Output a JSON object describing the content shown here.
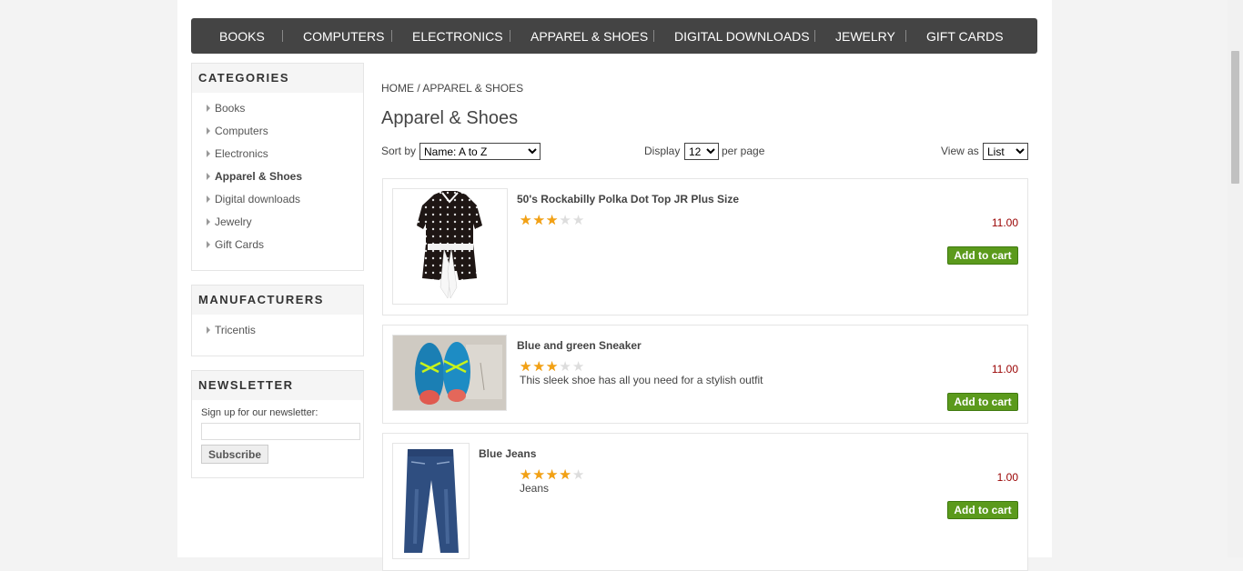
{
  "top_menu": [
    "BOOKS",
    "COMPUTERS",
    "ELECTRONICS",
    "APPAREL & SHOES",
    "DIGITAL DOWNLOADS",
    "JEWELRY",
    "GIFT CARDS"
  ],
  "categories": {
    "title": "CATEGORIES",
    "items": [
      "Books",
      "Computers",
      "Electronics",
      "Apparel & Shoes",
      "Digital downloads",
      "Jewelry",
      "Gift Cards"
    ],
    "active": "Apparel & Shoes"
  },
  "manufacturers": {
    "title": "MANUFACTURERS",
    "items": [
      "Tricentis"
    ]
  },
  "newsletter": {
    "title": "NEWSLETTER",
    "label": "Sign up for our newsletter:",
    "input_value": "",
    "button": "Subscribe"
  },
  "breadcrumb": {
    "home": "HOME",
    "separator": "/",
    "current": "APPAREL & SHOES"
  },
  "page_title": "Apparel & Shoes",
  "sort": {
    "label": "Sort by",
    "selected": "Name: A to Z"
  },
  "display": {
    "label": "Display",
    "selected": "12",
    "suffix": "per page"
  },
  "view": {
    "label": "View as",
    "selected": "List"
  },
  "products": [
    {
      "name": "50's Rockabilly Polka Dot Top JR Plus Size",
      "rating": 3,
      "max_rating": 5,
      "description": "",
      "price": "11.00",
      "button": "Add to cart",
      "image_icon": "polka-dot-top-image"
    },
    {
      "name": "Blue and green Sneaker",
      "rating": 3,
      "max_rating": 5,
      "description": "This sleek shoe has all you need for a stylish outfit",
      "price": "11.00",
      "button": "Add to cart",
      "image_icon": "sneaker-image"
    },
    {
      "name": "Blue Jeans",
      "rating": 4,
      "max_rating": 5,
      "description": "Jeans",
      "price": "1.00",
      "button": "Add to cart",
      "image_icon": "jeans-image"
    }
  ],
  "colors": {
    "menu_bg": "#444444",
    "price": "#990000",
    "cart_button": "#5b9a1c",
    "star": "#f2a115"
  }
}
